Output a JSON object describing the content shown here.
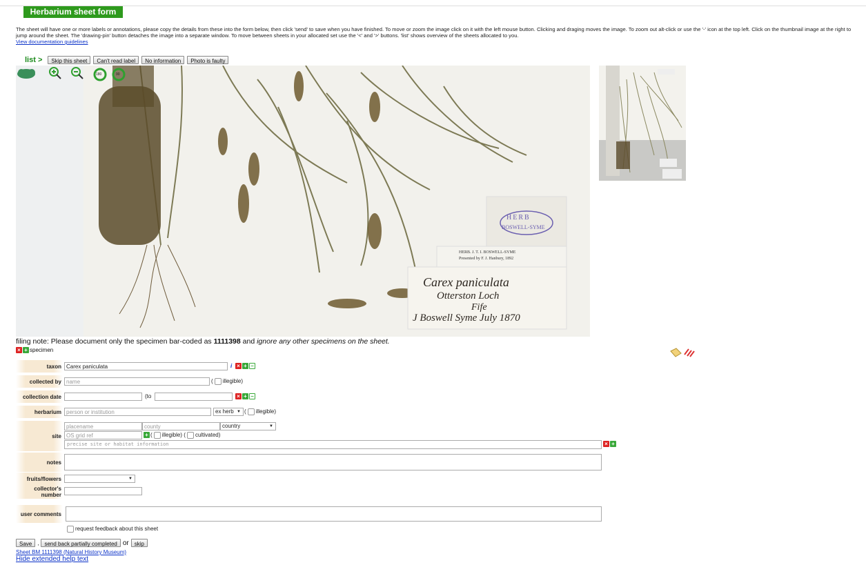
{
  "header": {
    "title": "Herbarium sheet form"
  },
  "help": {
    "text": "The sheet will have one or more labels or annotations, please copy the details from these into the form below, then click 'send' to save when you have finished. To move or zoom the image click on it with the left mouse button. Clicking and draging moves the image. To zoom out alt-click or use the '-' icon at the top left. Click on the thumbnail image at the right to jump around the sheet. The 'drawing-pin' button detaches the image into a separate window. To move between sheets in your allocated set use the '<' and '>' buttons. 'list' shows overview of the sheets allocated to you.",
    "guidelines_link": "View documentation guidelines"
  },
  "toolbar": {
    "list_label": "list >",
    "skip_label": "Skip this sheet",
    "cant_read_label": "Can't read label",
    "no_info_label": "No information",
    "faulty_label": "Photo is faulty"
  },
  "image": {
    "stamp_line1": "HERB",
    "stamp_line2": "BOSWELL-SYME",
    "printed_line1": "HERB. J. T. I. BOSWELL-SYME",
    "printed_line2": "Presented by F. J. Hanbury, 1892",
    "hand_line1": "Carex paniculata",
    "hand_line2": "Otterston Loch",
    "hand_line3": "Fife",
    "hand_line4": "J Boswell Syme July 1870",
    "rotate_left": "180",
    "rotate_right": "90"
  },
  "filing_note": {
    "prefix": "filing note: Please document only the specimen bar-coded as ",
    "barcode": "1111398",
    "mid": " and ",
    "suffix": "ignore any other specimens on the sheet."
  },
  "specimen_label": "specimen",
  "form": {
    "taxon_label": "taxon",
    "taxon_value": "Carex paniculata",
    "taxon_info": "i",
    "collected_by_label": "collected by",
    "collected_by_placeholder": "name",
    "illegible_label": "illegible)",
    "paren_open": "(",
    "collection_date_label": "collection date",
    "to_label": "(to",
    "herbarium_label": "herbarium",
    "herbarium_placeholder": "person or institution",
    "ex_herb_option": "ex herb",
    "site_label": "site",
    "placename_placeholder": "placename",
    "county_placeholder": "county",
    "country_option": "country",
    "grid_ref_placeholder": "OS grid ref",
    "cultivated_label": "cultivated)",
    "precise_site_placeholder": "precise site or habitat information",
    "notes_label": "notes",
    "fruits_label": "fruits/flowers",
    "collector_number_label_1": "collector's",
    "collector_number_label_2": "number",
    "user_comments_label": "user comments",
    "request_feedback_label": "request feedback about this sheet"
  },
  "actions": {
    "save_label": "Save",
    "comma": ",",
    "send_back_label": "send back partially completed",
    "or_label": "or",
    "skip_label": "skip"
  },
  "footer": {
    "sheet_link": "Sheet BM 1111398 (Natural History Museum)",
    "hide_help": "Hide extended help text"
  },
  "colors": {
    "title_bg": "#2e9a1d",
    "label_bg": "#f7e9d3",
    "link": "#0b32c8"
  }
}
